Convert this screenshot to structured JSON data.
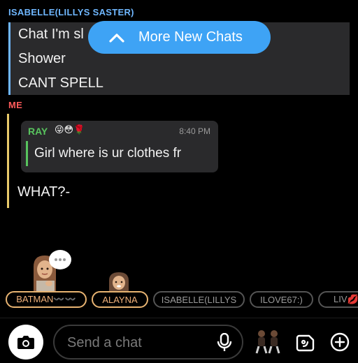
{
  "quoted_message": {
    "sender": "ISABELLE(LILLYS SASTER)",
    "lines": [
      "Chat I'm sl",
      "Shower",
      "CANT SPELL"
    ]
  },
  "banner": {
    "label": "More New Chats",
    "icon": "chevron-up-icon"
  },
  "me_section": {
    "label": "ME",
    "reply": {
      "name": "RAY",
      "emoji": "😜😳🌹",
      "time": "8:40 PM",
      "text": "Girl where is ur clothes fr"
    },
    "message": "WHAT?-"
  },
  "typing_indicator": "•••",
  "friends": [
    "BATMAN〰️〰️",
    "ALAYNA",
    "ISABELLE(LILLYS",
    "ILOVE67:)",
    "LIV💋"
  ],
  "composer": {
    "placeholder": "Send a chat",
    "icons": [
      "camera-icon",
      "mic-icon",
      "bitmoji-icon",
      "sticker-icon",
      "plus-icon"
    ]
  },
  "colors": {
    "background": "#000000",
    "accent_blue": "#3ea3f5",
    "me_label": "#ff5b5b",
    "reply_green": "#58c45e",
    "chip_highlight": "#e8b472"
  }
}
